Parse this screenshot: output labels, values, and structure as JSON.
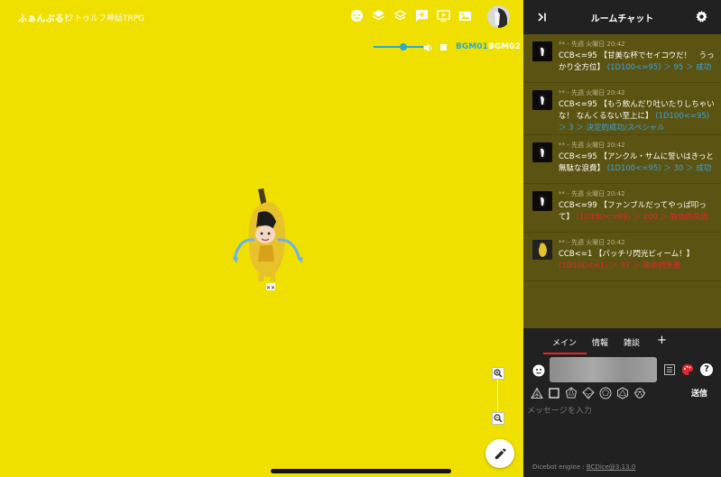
{
  "room": {
    "title": "ふぁんぶる！",
    "subtitle": "クトゥルフ神話TRPG"
  },
  "bgm": {
    "volume": 0.6,
    "track1": "BGM01",
    "track2": "BGM02"
  },
  "chat": {
    "title": "ルームチャット",
    "messages": [
      {
        "meta": "** - 先週 火曜日 20:42",
        "body": "CCB<=95 【甘美な杯でセイコウだ！　うっかり全方位】",
        "result": "(1D100<=95) ＞ 95 ＞ 成功",
        "result_type": "blue"
      },
      {
        "meta": "** - 先週 火曜日 20:42",
        "body": "CCB<=95 【もう飲んだり吐いたりしちゃいな！ なんくるない至上に】",
        "result": "(1D100<=95) ＞ 3 ＞ 決定的成功/スペシャル",
        "result_type": "blue"
      },
      {
        "meta": "** - 先週 火曜日 20:42",
        "body": "CCB<=95 【アンクル・サムに誓いはきっと無駄な浪費】",
        "result": "(1D100<=95) ＞ 30 ＞ 成功",
        "result_type": "blue"
      },
      {
        "meta": "** - 先週 火曜日 20:42",
        "body": "CCB<=99 【ファンブルだってやっぱ叩って】",
        "result": "(1D100<=99) ＞ 100 ＞ 致命的失敗",
        "result_type": "red"
      },
      {
        "meta": "** - 先週 火曜日 20:42",
        "body": "CCB<=1 【バッチリ閃光ビィーム！】",
        "result": "(1D100<=1) ＞ 97 ＞ 致命的失敗",
        "result_type": "red"
      }
    ],
    "tabs": [
      "メイン",
      "情報",
      "雑談"
    ],
    "add_tab": "+",
    "send": "送信",
    "input_placeholder": "メッセージを入力",
    "footer_label": "Dicebot engine : ",
    "footer_link": "BCDice@3.13.0"
  },
  "colors": {
    "stage_bg": "#efe000",
    "accent_blue": "#2aa8d6",
    "result_blue": "#3aa3e0",
    "result_red": "#e5262d",
    "chat_bg": "#5b5312"
  },
  "icons": {
    "toolbar": [
      "face-icon",
      "layers-icon",
      "layers-outline-icon",
      "add-comment-icon",
      "video-icon",
      "image-icon"
    ]
  }
}
